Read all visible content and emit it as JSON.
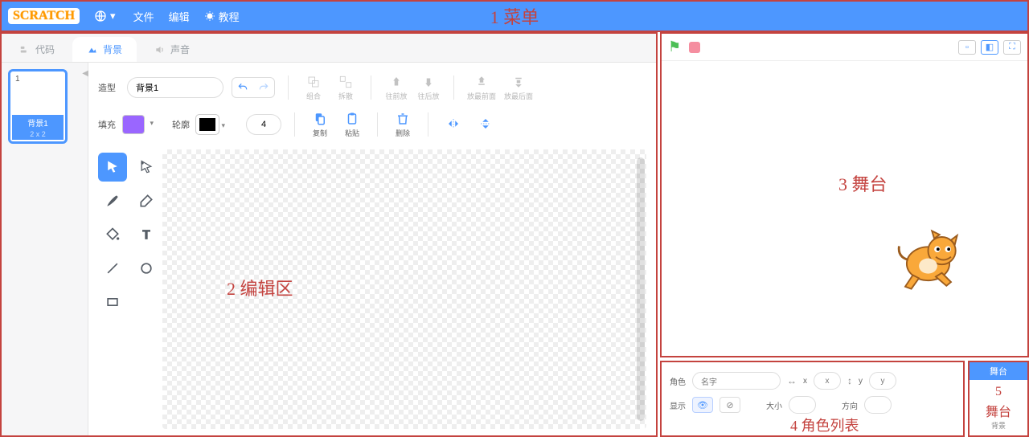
{
  "annotations": {
    "menu": "1 菜单",
    "editor": "2 编辑区",
    "stage": "3 舞台",
    "sprites": "4 角色列表",
    "stage_small_num": "5",
    "stage_small_text": "舞台"
  },
  "logo": "SCRATCH",
  "menu": {
    "file": "文件",
    "edit": "编辑",
    "tutorials": "教程"
  },
  "tabs": {
    "code": "代码",
    "backdrops": "背景",
    "sounds": "声音"
  },
  "costume": {
    "number": "1",
    "name": "背景1",
    "size": "2 x 2"
  },
  "editor": {
    "costume_label": "造型",
    "costume_name_value": "背景1",
    "fill_label": "填充",
    "stroke_label": "轮廓",
    "stroke_width": "4",
    "group": "组合",
    "ungroup": "拆散",
    "forward": "往前放",
    "backward": "往后放",
    "front": "放最前面",
    "back": "放最后面",
    "copy": "复制",
    "paste": "粘贴",
    "delete": "删除",
    "fill_color": "#9a66ff",
    "stroke_color": "#000000"
  },
  "sprite_panel": {
    "sprite_label": "角色",
    "name_placeholder": "名字",
    "x_label": "x",
    "y_label": "y",
    "x_value": "x",
    "y_value": "y",
    "show_label": "显示",
    "size_label": "大小",
    "direction_label": "方向"
  },
  "stage_small": {
    "header": "舞台",
    "backdrop_label": "背景"
  }
}
